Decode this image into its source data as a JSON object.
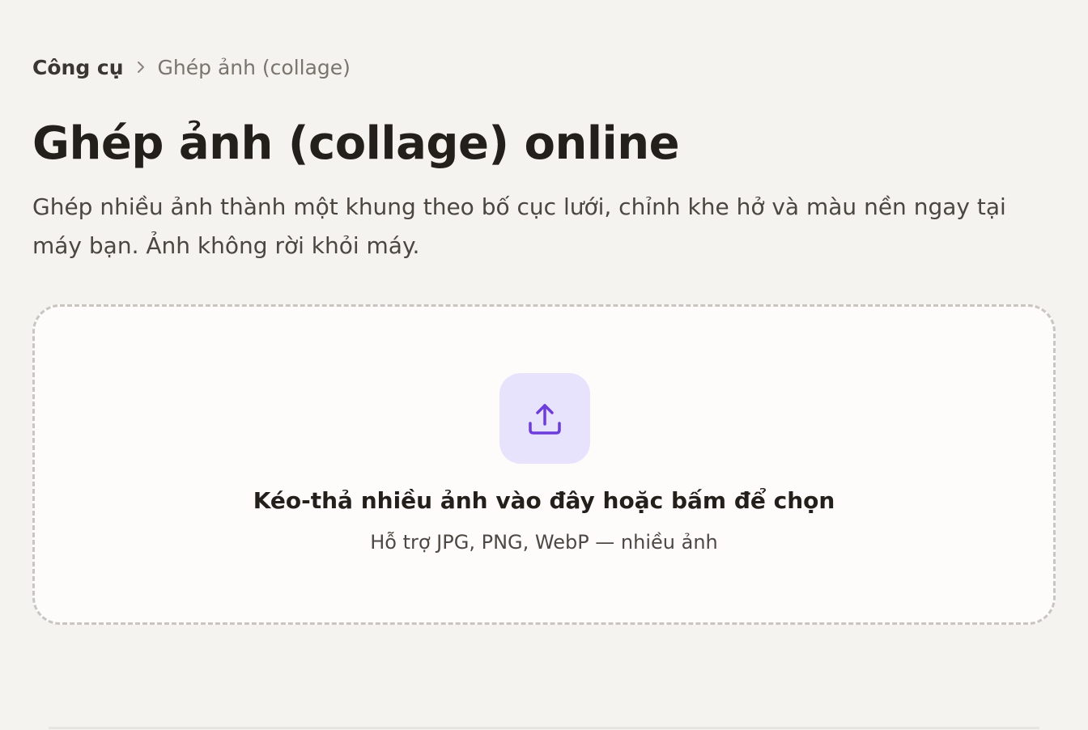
{
  "breadcrumb": {
    "root": "Công cụ",
    "separator_icon": "chevron-right-icon",
    "current": "Ghép ảnh (collage)"
  },
  "page": {
    "title": "Ghép ảnh (collage) online",
    "description": "Ghép nhiều ảnh thành một khung theo bố cục lưới, chỉnh khe hở và màu nền ngay tại máy bạn. Ảnh không rời khỏi máy."
  },
  "dropzone": {
    "icon": "upload-icon",
    "title": "Kéo-thả nhiều ảnh vào đây hoặc bấm để chọn",
    "subtitle": "Hỗ trợ JPG, PNG, WebP — nhiều ảnh"
  },
  "colors": {
    "background": "#f4f3f0",
    "accent": "#6d3ddc",
    "accent_soft": "#e8e3fd",
    "dropzone_border": "#c9c6c2"
  }
}
